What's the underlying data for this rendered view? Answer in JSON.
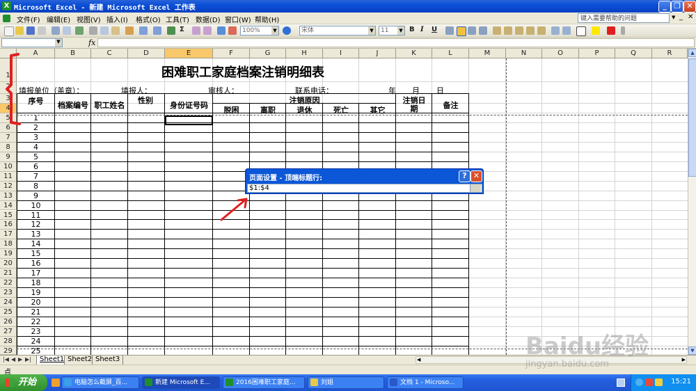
{
  "window": {
    "title": "Microsoft Excel - 新建 Microsoft Excel 工作表",
    "app_icon": "X"
  },
  "menu": {
    "items": [
      "文件(F)",
      "编辑(E)",
      "视图(V)",
      "插入(I)",
      "格式(O)",
      "工具(T)",
      "数据(D)",
      "窗口(W)",
      "帮助(H)"
    ],
    "help_placeholder": "键入需要帮助的问题"
  },
  "toolbar": {
    "zoom": "100%",
    "font": "宋体",
    "font_size": "11",
    "bold": "B",
    "italic": "I",
    "underline": "U",
    "sigma": "Σ"
  },
  "formula_bar": {
    "name_box": "",
    "fx": "fx",
    "content": ""
  },
  "columns": [
    "A",
    "B",
    "C",
    "D",
    "E",
    "F",
    "G",
    "H",
    "I",
    "J",
    "K",
    "L",
    "M",
    "N",
    "O",
    "P",
    "Q",
    "R"
  ],
  "selected_column": "E",
  "rows": [
    "1",
    "2",
    "3",
    "4",
    "5",
    "6",
    "7",
    "8",
    "9",
    "10",
    "11",
    "12",
    "13",
    "14",
    "15",
    "16",
    "17",
    "18",
    "19",
    "20",
    "21",
    "22",
    "23",
    "24",
    "25",
    "26",
    "27",
    "28",
    "29"
  ],
  "selected_row": "4",
  "sheet": {
    "title": "困难职工家庭档案注销明细表",
    "info": {
      "unit": "填报单位（盖章）：",
      "filler": "填报人：",
      "reviewer": "审核人：",
      "phone": "联系电话：",
      "year": "年",
      "month": "月",
      "day": "日"
    },
    "headers": {
      "seq": "序号",
      "file_no": "档案编号",
      "name": "职工姓名",
      "gender": "性别",
      "id_no": "身份证号码",
      "reason": "注销原因",
      "reason_sub": [
        "脱困",
        "离职",
        "退休",
        "死亡",
        "其它"
      ],
      "date": "注销日期",
      "remark": "备注"
    },
    "serials": [
      "1",
      "2",
      "3",
      "4",
      "5",
      "6",
      "7",
      "8",
      "9",
      "10",
      "11",
      "12",
      "13",
      "14",
      "15",
      "16",
      "17",
      "18",
      "19",
      "20",
      "21",
      "22",
      "23",
      "24",
      "25"
    ]
  },
  "sheet_tabs": [
    "Sheet1",
    "Sheet2",
    "Sheet3"
  ],
  "active_sheet": "Sheet1",
  "status": {
    "text": "点"
  },
  "dialog": {
    "title": "页面设置 - 顶端标题行:",
    "value": "$1:$4",
    "help": "?",
    "close": "✕"
  },
  "taskbar": {
    "start": "开始",
    "items": [
      "电脑怎么截屏_百...",
      "新建 Microsoft E...",
      "2016困难职工家庭...",
      "刘姐",
      "文档 1 - Microso..."
    ],
    "clock": "15:21"
  },
  "watermark": {
    "brand": "Baidu经验",
    "url": "jingyan.baidu.com"
  },
  "colors": {
    "title_bar": "#0a4fd8",
    "selected_header": "#f9c86a",
    "annotation": "#e02020",
    "taskbar": "#245edb",
    "start": "#3c9a38"
  }
}
